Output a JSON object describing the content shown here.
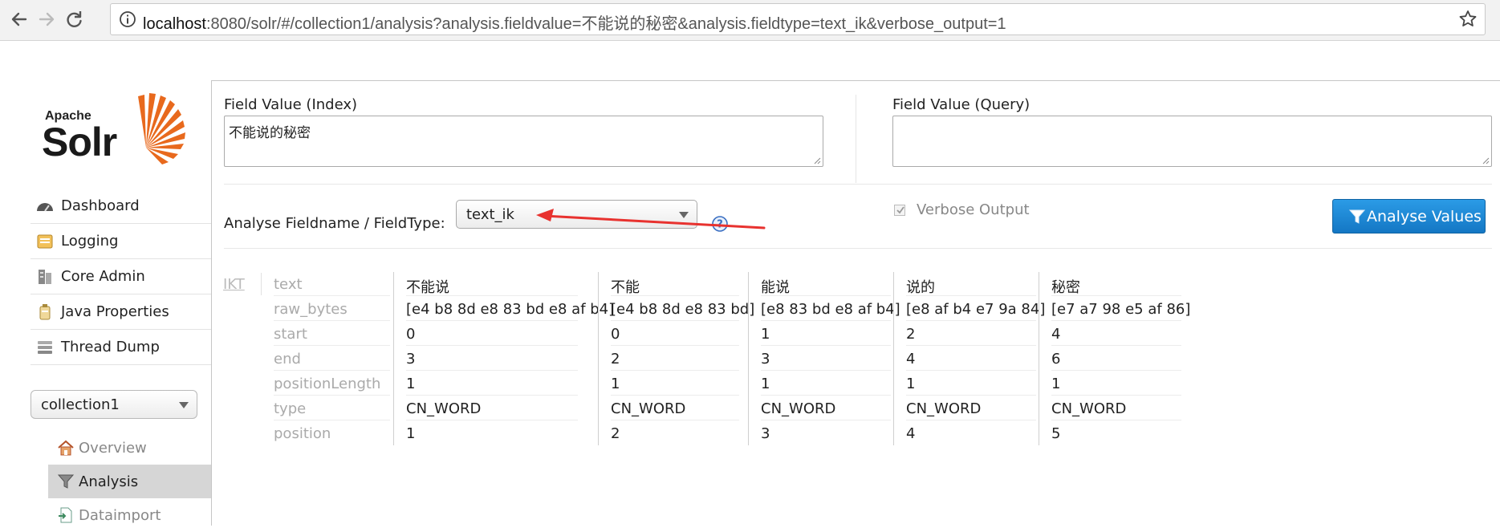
{
  "browser": {
    "url_host": "localhost",
    "url_rest": ":8080/solr/#/collection1/analysis?analysis.fieldvalue=不能说的秘密&analysis.fieldtype=text_ik&verbose_output=1"
  },
  "logo": {
    "apache": "Apache",
    "solr": "Solr"
  },
  "sidebar": {
    "menu": [
      {
        "label": "Dashboard",
        "icon": "dashboard-icon"
      },
      {
        "label": "Logging",
        "icon": "logging-icon"
      },
      {
        "label": "Core Admin",
        "icon": "core-admin-icon"
      },
      {
        "label": "Java Properties",
        "icon": "java-properties-icon"
      },
      {
        "label": "Thread Dump",
        "icon": "thread-dump-icon"
      }
    ],
    "core_selector": "collection1",
    "submenu": [
      {
        "label": "Overview",
        "icon": "home-icon"
      },
      {
        "label": "Analysis",
        "icon": "funnel-icon",
        "active": true
      },
      {
        "label": "Dataimport",
        "icon": "dataimport-icon"
      }
    ]
  },
  "form": {
    "index_label": "Field Value (Index)",
    "index_value": "不能说的秘密",
    "query_label": "Field Value (Query)",
    "query_value": "",
    "fieldtype_label": "Analyse Fieldname / FieldType:",
    "fieldtype_value": "text_ik",
    "verbose_label": "Verbose Output",
    "verbose_checked": true,
    "analyse_button": "Analyse Values"
  },
  "analysis": {
    "tokenizer": "IKT",
    "attributes": [
      "text",
      "raw_bytes",
      "start",
      "end",
      "positionLength",
      "type",
      "position"
    ],
    "tokens": [
      {
        "text": "不能说",
        "raw_bytes": "[e4 b8 8d e8 83 bd e8 af b4]",
        "start": "0",
        "end": "3",
        "positionLength": "1",
        "type": "CN_WORD",
        "position": "1"
      },
      {
        "text": "不能",
        "raw_bytes": "[e4 b8 8d e8 83 bd]",
        "start": "0",
        "end": "2",
        "positionLength": "1",
        "type": "CN_WORD",
        "position": "2"
      },
      {
        "text": "能说",
        "raw_bytes": "[e8 83 bd e8 af b4]",
        "start": "1",
        "end": "3",
        "positionLength": "1",
        "type": "CN_WORD",
        "position": "3"
      },
      {
        "text": "说的",
        "raw_bytes": "[e8 af b4 e7 9a 84]",
        "start": "2",
        "end": "4",
        "positionLength": "1",
        "type": "CN_WORD",
        "position": "4"
      },
      {
        "text": "秘密",
        "raw_bytes": "[e7 a7 98 e5 af 86]",
        "start": "4",
        "end": "6",
        "positionLength": "1",
        "type": "CN_WORD",
        "position": "5"
      }
    ]
  },
  "colors": {
    "accent": "#1a82d2",
    "annotation_arrow": "#e8322f"
  }
}
